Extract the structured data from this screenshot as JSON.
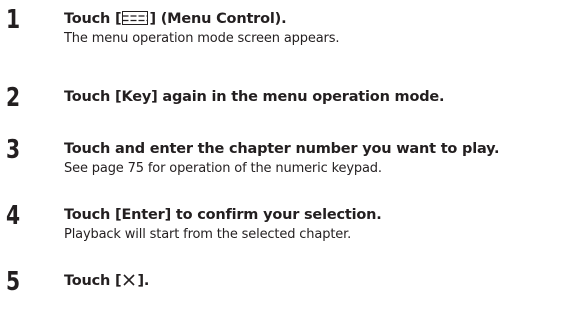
{
  "steps": [
    {
      "number": "1",
      "title_prefix": "Touch [",
      "title_icon": "menu-control-icon",
      "title_suffix": "] (Menu Control).",
      "description": "The menu operation mode screen appears."
    },
    {
      "number": "2",
      "title": "Touch [Key] again in the menu operation mode.",
      "description": ""
    },
    {
      "number": "3",
      "title": "Touch and enter the chapter number you want to play.",
      "description": "See page 75 for operation of the numeric keypad."
    },
    {
      "number": "4",
      "title": "Touch [Enter] to confirm your selection.",
      "description": "Playback will start from the selected chapter."
    },
    {
      "number": "5",
      "title_prefix": "Touch [",
      "title_icon": "close-icon",
      "title_suffix": "].",
      "description": ""
    }
  ]
}
